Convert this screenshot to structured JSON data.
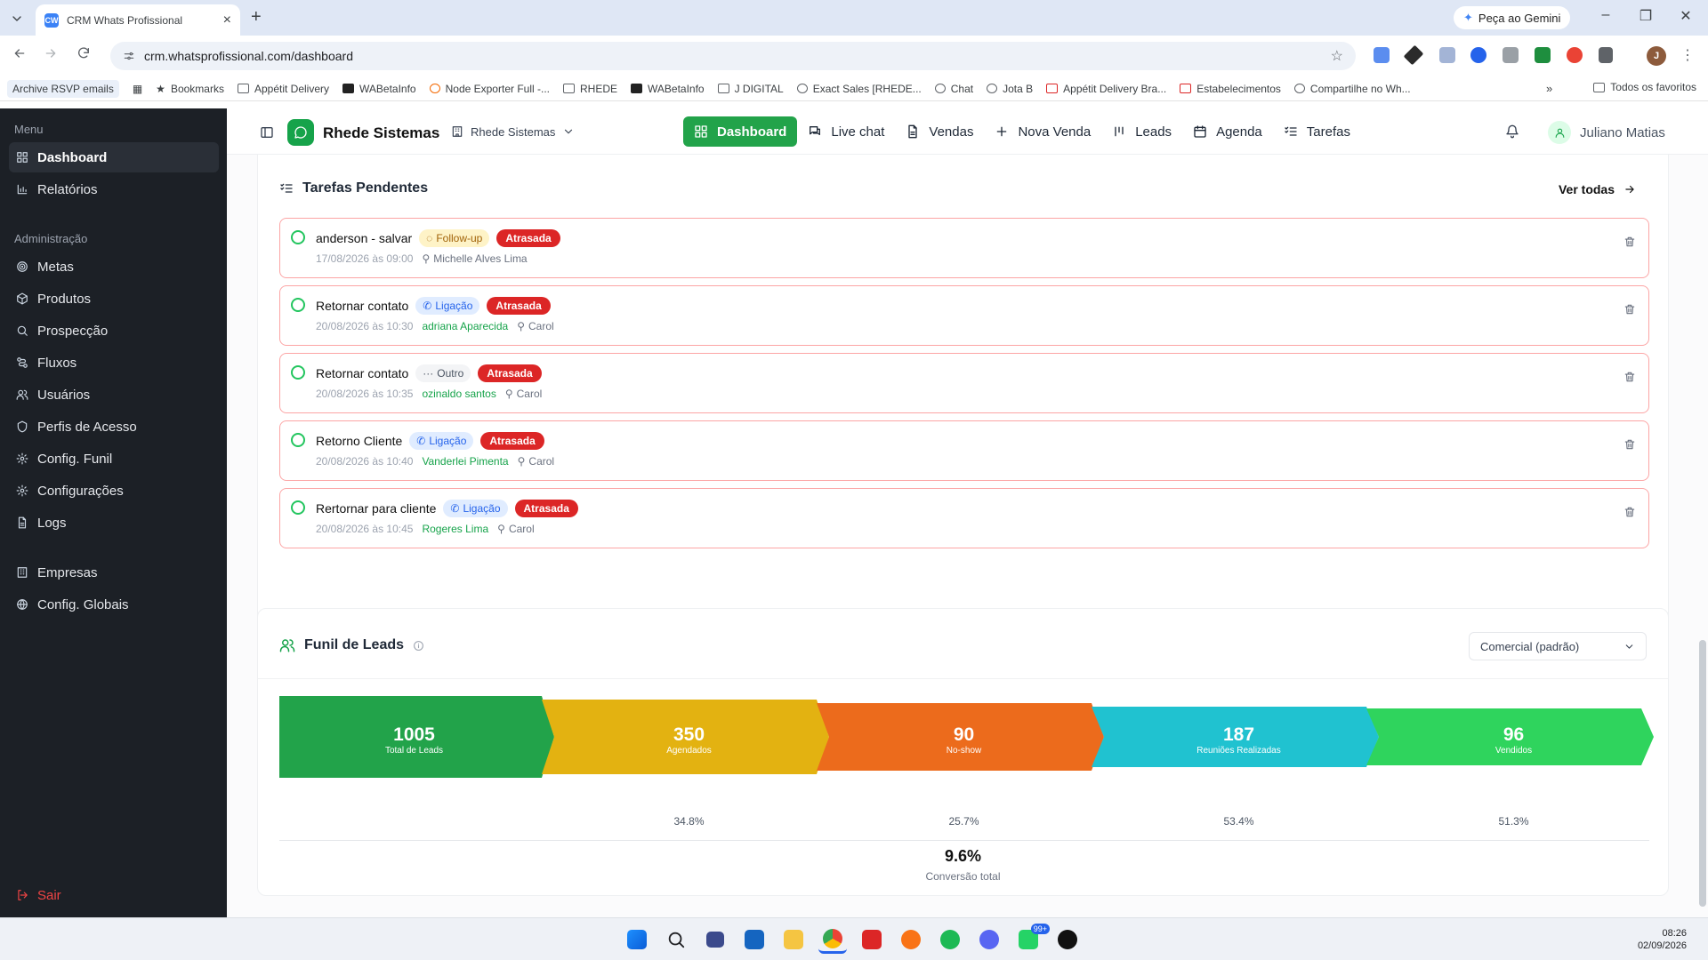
{
  "browser": {
    "tab_title": "CRM Whats Profissional",
    "favicon_text": "CW",
    "url": "crm.whatsprofissional.com/dashboard",
    "gemini_label": "Peça ao Gemini",
    "profile_initial": "J"
  },
  "bookmarks": {
    "items": [
      "Archive RSVP emails",
      "Bookmarks",
      "Appétit Delivery",
      "WABetaInfo",
      "Node Exporter Full -...",
      "RHEDE",
      "WABetaInfo",
      "J DIGITAL",
      "Exact Sales [RHEDE...",
      "Chat",
      "Jota B",
      "Appétit Delivery Bra...",
      "Estabelecimentos",
      "Compartilhe no Wh..."
    ],
    "all_label": "Todos os favoritos"
  },
  "sidebar": {
    "menu_label": "Menu",
    "menu_items": [
      "Dashboard",
      "Relatórios"
    ],
    "admin_label": "Administração",
    "admin_items": [
      "Metas",
      "Produtos",
      "Prospecção",
      "Fluxos",
      "Usuários",
      "Perfis de Acesso",
      "Config. Funil",
      "Configurações",
      "Logs"
    ],
    "extra_items": [
      "Empresas",
      "Config. Globais"
    ],
    "logout": "Sair"
  },
  "header": {
    "brand": "Rhede Sistemas",
    "company_select": "Rhede Sistemas",
    "nav": [
      "Dashboard",
      "Live chat",
      "Vendas",
      "Nova Venda",
      "Leads",
      "Agenda",
      "Tarefas"
    ],
    "user": "Juliano Matias"
  },
  "tasks": {
    "title": "Tarefas Pendentes",
    "view_all": "Ver todas",
    "items": [
      {
        "title": "anderson - salvar",
        "type": "Follow-up",
        "status": "Atrasada",
        "datetime": "17/08/2026 às 09:00",
        "lead": "",
        "assignee": "Michelle Alves Lima"
      },
      {
        "title": "Retornar contato",
        "type": "Ligação",
        "status": "Atrasada",
        "datetime": "20/08/2026 às 10:30",
        "lead": "adriana Aparecida",
        "assignee": "Carol"
      },
      {
        "title": "Retornar contato",
        "type": "Outro",
        "status": "Atrasada",
        "datetime": "20/08/2026 às 10:35",
        "lead": "ozinaldo santos",
        "assignee": "Carol"
      },
      {
        "title": "Retorno Cliente",
        "type": "Ligação",
        "status": "Atrasada",
        "datetime": "20/08/2026 às 10:40",
        "lead": "Vanderlei Pimenta",
        "assignee": "Carol"
      },
      {
        "title": "Rertornar para cliente",
        "type": "Ligação",
        "status": "Atrasada",
        "datetime": "20/08/2026 às 10:45",
        "lead": "Rogeres Lima",
        "assignee": "Carol"
      }
    ]
  },
  "funnel": {
    "title": "Funil de Leads",
    "select_value": "Comercial (padrão)",
    "stages": [
      {
        "value": "1005",
        "label": "Total de Leads",
        "color": "#22a34a"
      },
      {
        "value": "350",
        "label": "Agendados",
        "color": "#e3b211"
      },
      {
        "value": "90",
        "label": "No-show",
        "color": "#ec6b1c"
      },
      {
        "value": "187",
        "label": "Reuniões Realizadas",
        "color": "#20c2d0"
      },
      {
        "value": "96",
        "label": "Vendidos",
        "color": "#2fd45d"
      }
    ],
    "rates": [
      "34.8%",
      "25.7%",
      "53.4%",
      "51.3%"
    ],
    "total_conversion": "9.6%",
    "total_conversion_label": "Conversão total"
  },
  "taskbar": {
    "time": "08:26",
    "date": "02/09/2026",
    "whatsapp_badge": "99+"
  }
}
